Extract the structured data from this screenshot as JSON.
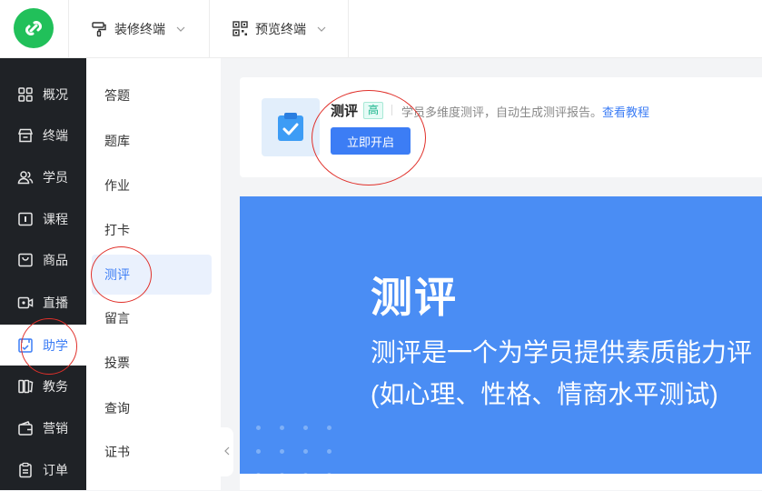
{
  "topbar": {
    "decorate_label": "装修终端",
    "preview_label": "预览终端"
  },
  "side1": {
    "items": [
      {
        "label": "概况",
        "icon": "grid-icon"
      },
      {
        "label": "终端",
        "icon": "store-icon"
      },
      {
        "label": "学员",
        "icon": "users-icon"
      },
      {
        "label": "课程",
        "icon": "course-icon"
      },
      {
        "label": "商品",
        "icon": "bag-icon"
      },
      {
        "label": "直播",
        "icon": "video-icon"
      },
      {
        "label": "助学",
        "icon": "assist-icon"
      },
      {
        "label": "教务",
        "icon": "books-icon"
      },
      {
        "label": "营销",
        "icon": "wallet-icon"
      },
      {
        "label": "订单",
        "icon": "clipboard-icon"
      }
    ],
    "active_index": 6
  },
  "side2": {
    "items": [
      "答题",
      "题库",
      "作业",
      "打卡",
      "测评",
      "留言",
      "投票",
      "查询",
      "证书"
    ],
    "active_index": 4
  },
  "card": {
    "title": "测评",
    "tag": "高",
    "desc": "学员多维度测评，自动生成测评报告。",
    "link": "查看教程",
    "button": "立即开启"
  },
  "banner": {
    "title": "测评",
    "line1": "测评是一个为学员提供素质能力评",
    "line2": "(如心理、性格、情商水平测试)"
  },
  "colors": {
    "accent": "#3c7df5",
    "sidebar_bg": "#1f2226",
    "banner_bg": "#4a8df4",
    "annotation": "#e0302a"
  }
}
